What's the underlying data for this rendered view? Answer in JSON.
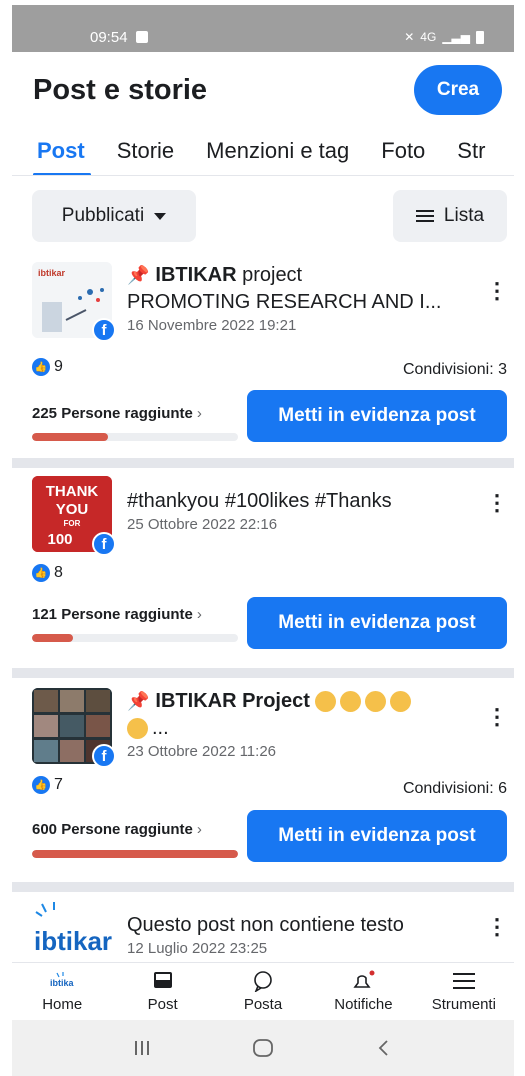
{
  "status_bar": {
    "time": "09:54",
    "signal_text": "4G"
  },
  "header": {
    "title": "Post e storie",
    "create_label": "Crea"
  },
  "tabs": [
    {
      "label": "Post"
    },
    {
      "label": "Storie"
    },
    {
      "label": "Menzioni e tag"
    },
    {
      "label": "Foto"
    },
    {
      "label": "Str"
    }
  ],
  "filters": {
    "status_label": "Pubblicati",
    "view_label": "Lista"
  },
  "posts": [
    {
      "thumb_text": "ibtikar",
      "author": "IBTIKAR",
      "title_rest": " project",
      "text": "PROMOTING RESEARCH AND I...",
      "date": "16 Novembre 2022 19:21",
      "likes": "9",
      "shares": "Condivisioni: 3",
      "reach_label": "225 Persone raggiunte",
      "reach_fraction": 0.37,
      "boost_label": "Metti in evidenza post"
    },
    {
      "thumb_text": [
        "THANK",
        "YOU",
        "FOR",
        "100"
      ],
      "text": "#thankyou #100likes #Thanks",
      "date": "25 Ottobre 2022 22:16",
      "likes": "8",
      "reach_label": "121 Persone raggiunte",
      "reach_fraction": 0.2,
      "boost_label": "Metti in evidenza post"
    },
    {
      "author": "IBTIKAR Project",
      "text": "...",
      "date": "23 Ottobre 2022 11:26",
      "likes": "7",
      "shares": "Condivisioni: 6",
      "reach_label": "600 Persone raggiunte",
      "reach_fraction": 1.0,
      "boost_label": "Metti in evidenza post"
    },
    {
      "thumb_text": "ibtikar",
      "text": "Questo post non contiene testo",
      "date": "12 Luglio 2022 23:25"
    }
  ],
  "bottom_nav": [
    {
      "label": "Home",
      "icon": "ibtikar-logo-icon"
    },
    {
      "label": "Post",
      "icon": "post-stack-icon"
    },
    {
      "label": "Posta",
      "icon": "chat-bubble-icon"
    },
    {
      "label": "Notifiche",
      "icon": "bell-icon"
    },
    {
      "label": "Strumenti",
      "icon": "menu-icon"
    }
  ],
  "colors": {
    "accent": "#1877f2",
    "reach_bar": "#d65a4b",
    "tab_active": "#1877f2"
  }
}
